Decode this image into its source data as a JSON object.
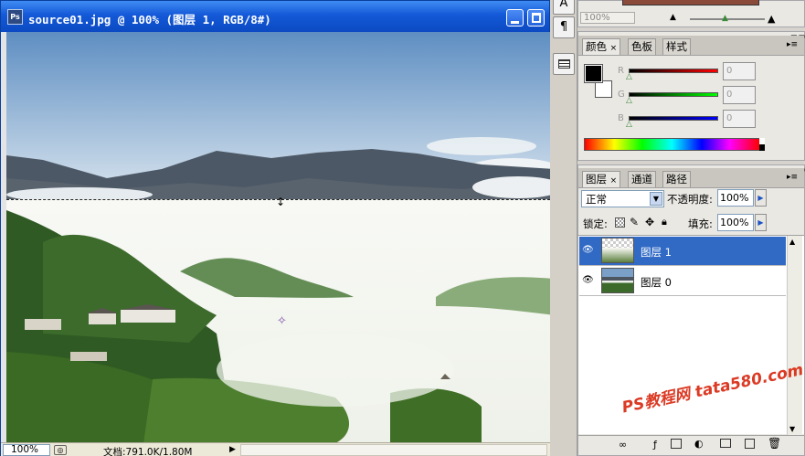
{
  "window": {
    "title": "source01.jpg @ 100% (图层 1, RGB/8#)",
    "app_icon": "Ps"
  },
  "status": {
    "zoom": "100%",
    "doc_info": "文档:791.0K/1.80M"
  },
  "toolstrip": {
    "icons": [
      "type-tool-icon",
      "paragraph-icon",
      "info-panel-icon"
    ],
    "paragraph_glyph": "¶",
    "type_glyph": "A"
  },
  "navigator": {
    "zoom": "100%"
  },
  "color_panel": {
    "tabs": [
      "颜色",
      "色板",
      "样式"
    ],
    "channels": [
      {
        "label": "R",
        "value": "0"
      },
      {
        "label": "G",
        "value": "0"
      },
      {
        "label": "B",
        "value": "0"
      }
    ]
  },
  "layers_panel": {
    "tabs": [
      "图层",
      "通道",
      "路径"
    ],
    "blend_mode": "正常",
    "opacity_label": "不透明度:",
    "opacity_value": "100%",
    "lock_label": "锁定:",
    "fill_label": "填充:",
    "fill_value": "100%",
    "layers": [
      {
        "name": "图层 1",
        "selected": true
      },
      {
        "name": "图层 0",
        "selected": false
      }
    ]
  },
  "watermark": "PS教程网 tata580.com",
  "colors": {
    "title_bar": "#1459d8",
    "selection": "#316ac5",
    "watermark": "#d92a12"
  }
}
